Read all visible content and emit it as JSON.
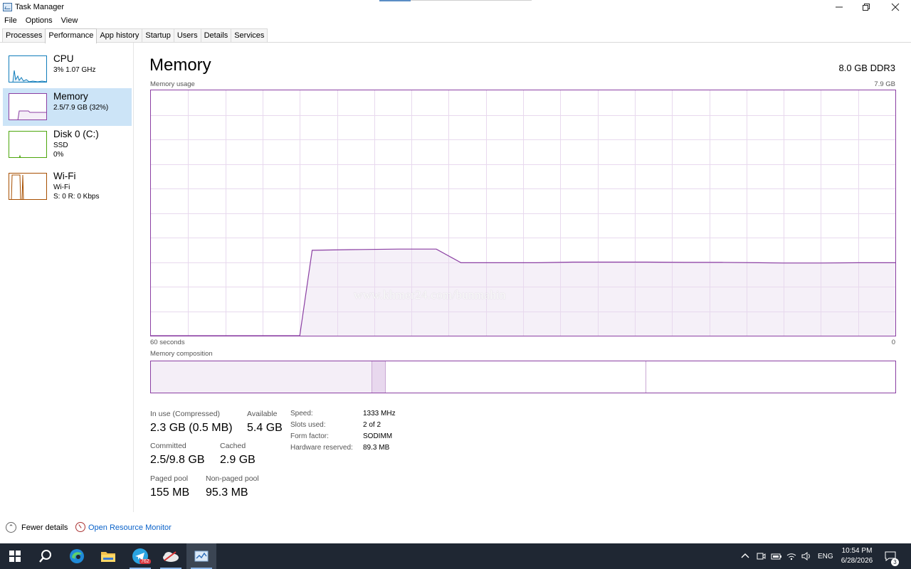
{
  "window": {
    "title": "Task Manager"
  },
  "menu": [
    "File",
    "Options",
    "View"
  ],
  "tabs": [
    "Processes",
    "Performance",
    "App history",
    "Startup",
    "Users",
    "Details",
    "Services"
  ],
  "sidebar": {
    "items": [
      {
        "name": "CPU",
        "line1": "3%  1.07 GHz",
        "line2": ""
      },
      {
        "name": "Memory",
        "line1": "2.5/7.9 GB (32%)",
        "line2": ""
      },
      {
        "name": "Disk 0 (C:)",
        "line1": "SSD",
        "line2": "0%"
      },
      {
        "name": "Wi-Fi",
        "line1": "Wi-Fi",
        "line2": "S: 0  R: 0 Kbps"
      }
    ]
  },
  "main": {
    "title": "Memory",
    "spec": "8.0 GB DDR3",
    "usage_label": "Memory usage",
    "usage_max": "7.9 GB",
    "axis_left": "60 seconds",
    "axis_right": "0",
    "composition_label": "Memory composition",
    "watermark": "www.khmer24.com/bunmahin"
  },
  "chart_data": {
    "type": "area",
    "title": "Memory usage",
    "x_range_seconds": [
      60,
      0
    ],
    "ylim": [
      0,
      7.9
    ],
    "unit": "GB",
    "x": [
      60,
      48,
      47,
      44,
      40,
      37,
      35,
      32,
      29,
      26,
      20,
      17,
      14,
      11,
      9,
      6,
      3,
      0
    ],
    "values": [
      0,
      0,
      2.75,
      2.77,
      2.79,
      2.79,
      2.35,
      2.35,
      2.35,
      2.37,
      2.37,
      2.36,
      2.36,
      2.35,
      2.34,
      2.34,
      2.35,
      2.35
    ]
  },
  "composition": {
    "in_use_fraction": 0.297,
    "modified_fraction": 0.018,
    "standby_fraction": 0.35,
    "free_fraction": 0.335
  },
  "stats": {
    "in_use_label": "In use (Compressed)",
    "in_use_value": "2.3 GB (0.5 MB)",
    "available_label": "Available",
    "available_value": "5.4 GB",
    "committed_label": "Committed",
    "committed_value": "2.5/9.8 GB",
    "cached_label": "Cached",
    "cached_value": "2.9 GB",
    "paged_label": "Paged pool",
    "paged_value": "155 MB",
    "nonpaged_label": "Non-paged pool",
    "nonpaged_value": "95.3 MB"
  },
  "specs": [
    {
      "label": "Speed:",
      "value": "1333 MHz"
    },
    {
      "label": "Slots used:",
      "value": "2 of 2"
    },
    {
      "label": "Form factor:",
      "value": "SODIMM"
    },
    {
      "label": "Hardware reserved:",
      "value": "89.3 MB"
    }
  ],
  "footer": {
    "fewer_details": "Fewer details",
    "open_monitor": "Open Resource Monitor"
  },
  "taskbar": {
    "telegram_badge": "762",
    "language": "ENG",
    "time": "10:54 PM",
    "date": "6/28/2026",
    "notification_count": "3"
  },
  "colors": {
    "memory": "#8b3fa3",
    "memory_fill": "#f4eef7",
    "cpu": "#117dbb",
    "disk": "#4da60c",
    "wifi": "#a74f01",
    "selection": "#cce4f7",
    "taskbar": "#1f2733"
  }
}
